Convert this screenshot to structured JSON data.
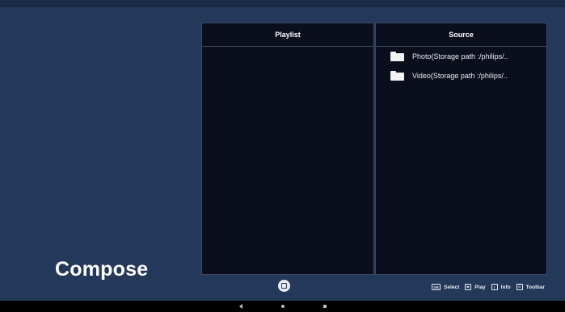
{
  "page": {
    "title": "Compose"
  },
  "playlist": {
    "header": "Playlist",
    "items": []
  },
  "source": {
    "header": "Source",
    "items": [
      {
        "label": "Photo(Storage path :/philips/..",
        "icon": "folder-icon"
      },
      {
        "label": "Video(Storage path :/philips/..",
        "icon": "folder-icon"
      }
    ]
  },
  "footer": {
    "center_button_icon": "square-circle-icon",
    "legend": [
      {
        "key": "OK",
        "label": "Select"
      },
      {
        "key": "▶",
        "label": "Play"
      },
      {
        "key": "i",
        "label": "Info"
      },
      {
        "key": "☰",
        "label": "Toolbar"
      }
    ]
  },
  "navbar": {
    "icons": [
      "back-icon",
      "home-icon",
      "recents-icon"
    ]
  },
  "colors": {
    "background": "#24385a",
    "panel": "#0b0f1c",
    "border": "#3a4a63"
  }
}
